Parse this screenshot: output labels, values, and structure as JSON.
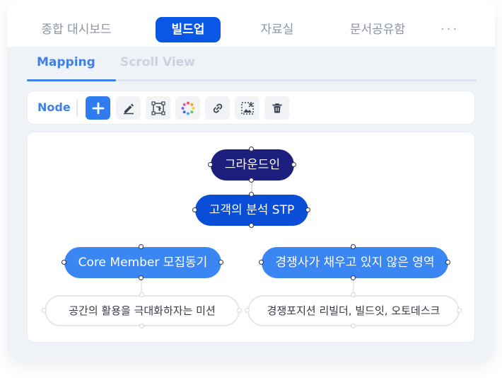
{
  "nav": {
    "items": [
      "종합 대시보드",
      "빌드업",
      "자료실",
      "문서공유함"
    ],
    "active_index": 1,
    "more_label": "···"
  },
  "subtabs": {
    "mapping": "Mapping",
    "scroll_view": "Scroll View"
  },
  "toolbar": {
    "label": "Node",
    "buttons": [
      "plus-icon",
      "pencil-icon",
      "text-frame-icon",
      "color-palette-icon",
      "link-icon",
      "image-icon",
      "trash-icon"
    ]
  },
  "mindmap": {
    "root": "그라운드인",
    "main": "고객의 분석 STP",
    "sub_left": "Core Member 모집동기",
    "sub_right": "경쟁사가 채우고 있지 않은 영역",
    "leaf_left": "공간의 활용을 극대화하자는 미션",
    "leaf_right": "경쟁포지션 리빌더, 빌드잇, 오토데스크"
  },
  "colors": {
    "accent": "#0a57e6",
    "root_node": "#1c1f7d",
    "main_node": "#0a4dd6",
    "sub_node": "#3a86f3",
    "tab_active": "#3f7fe8"
  }
}
